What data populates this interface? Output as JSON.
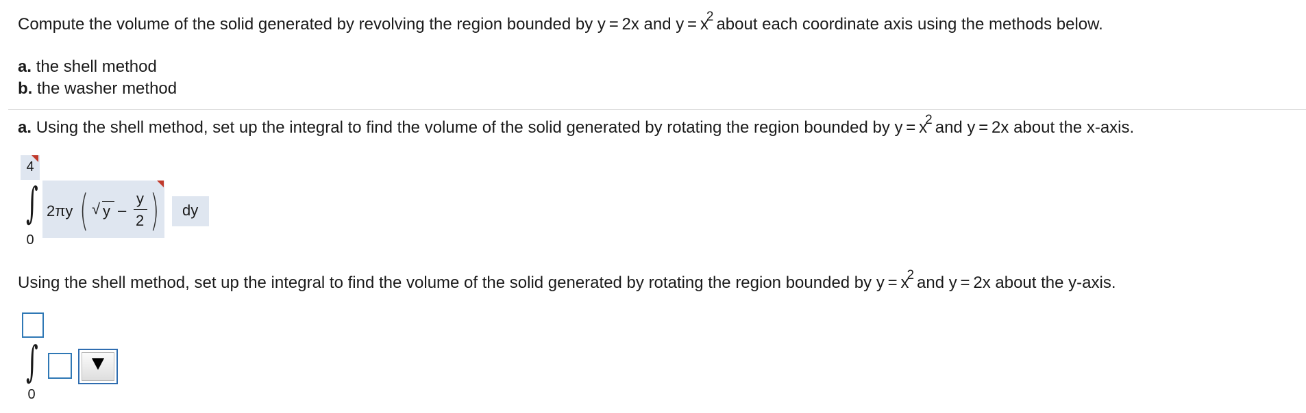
{
  "question": {
    "intro_before": "Compute the volume of the solid generated by revolving the region bounded by y = 2x and y = x",
    "intro_exp": "2",
    "intro_after": "about each coordinate axis using the methods below.",
    "part_a_label": "a.",
    "part_a_text": "the shell method",
    "part_b_label": "b.",
    "part_b_text": "the washer method"
  },
  "part_a": {
    "label": "a.",
    "prompt_before": "Using the shell method, set up the integral to find the volume of the solid generated by rotating the region bounded by y = x",
    "prompt_exp": "2",
    "prompt_after": "and y = 2x about the x-axis.",
    "integral": {
      "upper": "4",
      "lower": "0",
      "integrand_lead": "2πy",
      "sqrt_symbol": "√",
      "sqrt_arg": "y",
      "minus": "–",
      "frac_num": "y",
      "frac_den": "2",
      "differential": "dy"
    }
  },
  "part_a2": {
    "prompt_before": "Using the shell method, set up the integral to find the volume of the solid generated by rotating the region bounded by y = x",
    "prompt_exp": "2",
    "prompt_after": "and y = 2x about the y-axis.",
    "integral": {
      "lower": "0",
      "upper_value": "",
      "integrand_value": "",
      "differential_selected": ""
    }
  },
  "colors": {
    "accent_border": "#2f78b5",
    "answer_shade": "#dfe6f0",
    "flag_red": "#c0392b"
  }
}
